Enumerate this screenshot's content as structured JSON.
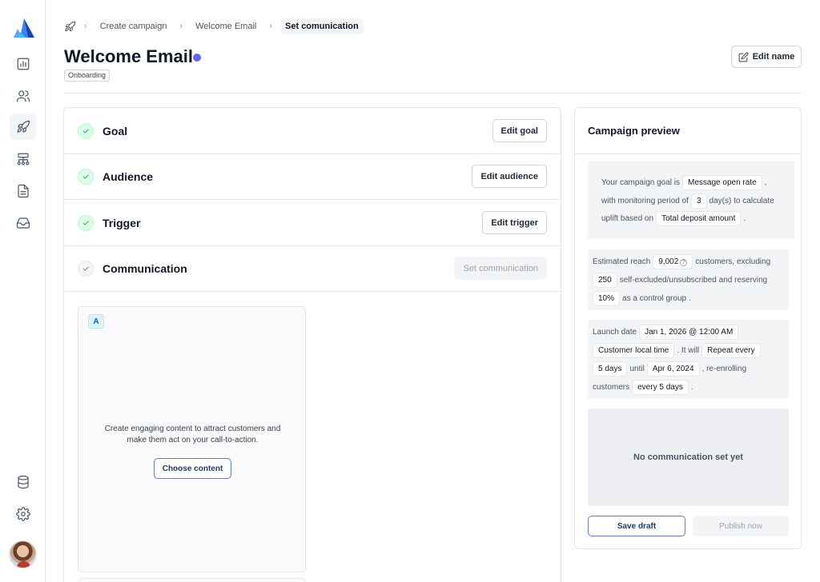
{
  "sidebar": {
    "logo": "app-logo",
    "items": [
      {
        "name": "analytics",
        "icon": "bar-chart-icon"
      },
      {
        "name": "customers",
        "icon": "users-icon"
      },
      {
        "name": "campaigns",
        "icon": "rocket-icon",
        "active": true
      },
      {
        "name": "flows",
        "icon": "hierarchy-icon"
      },
      {
        "name": "templates",
        "icon": "document-icon"
      },
      {
        "name": "inbox",
        "icon": "inbox-icon"
      },
      {
        "name": "database",
        "icon": "database-icon"
      },
      {
        "name": "settings",
        "icon": "gear-icon"
      }
    ],
    "user": "avatar"
  },
  "breadcrumb": {
    "icon": "rocket-icon",
    "items": [
      "Create campaign",
      "Welcome Email",
      "Set comunication"
    ]
  },
  "header": {
    "title": "Welcome Email",
    "status_color": "#6366f1",
    "tag": "Onboarding",
    "edit_name_label": "Edit name"
  },
  "steps": [
    {
      "label": "Goal",
      "button": "Edit goal",
      "done": true
    },
    {
      "label": "Audience",
      "button": "Edit audience",
      "done": true
    },
    {
      "label": "Trigger",
      "button": "Edit trigger",
      "done": true
    },
    {
      "label": "Communication",
      "button": "Set communication",
      "done": false
    }
  ],
  "communication": {
    "variant": "A",
    "text": "Create engaging content to attract customers and make them act on your call-to-action.",
    "choose_label": "Choose content"
  },
  "preview": {
    "title": "Campaign preview",
    "goal": {
      "t1": "Your campaign goal is",
      "goal_value": "Message open rate",
      "t2": ",",
      "t3": "with monitoring period of",
      "period": "3",
      "t4": "day(s) to calculate",
      "t5": "uplift based on",
      "metric": "Total deposit amount",
      "t6": "."
    },
    "reach": {
      "t1": "Estimated reach",
      "reach": "9,002",
      "help": "?",
      "t2": "customers, excluding",
      "excluded": "250",
      "t3": "self-excluded/unsubscribed and reserving",
      "control": "10%",
      "t4": "as a control group ."
    },
    "schedule": {
      "t1": "Launch date",
      "launch": "Jan 1, 2026 @ 12:00 AM",
      "tz": "Customer local time",
      "t2": ". It will",
      "repeat": "Repeat every",
      "interval": "5 days",
      "t3": "until",
      "until": "Apr 6, 2024",
      "t4": ", re-enrolling",
      "t5": "customers",
      "reenroll": "every 5 days",
      "t6": "."
    },
    "empty": "No communication set yet",
    "save_label": "Save draft",
    "publish_label": "Publish now"
  }
}
